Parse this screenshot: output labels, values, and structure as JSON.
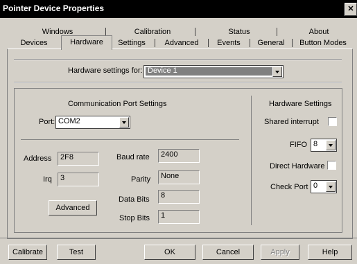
{
  "window": {
    "title": "Pointer Device Properties",
    "close_glyph": "✕"
  },
  "tabs_row1": [
    "Windows",
    "Calibration",
    "Status",
    "About"
  ],
  "tabs_row2": [
    "Devices",
    "Hardware",
    "Settings",
    "Advanced",
    "Events",
    "General",
    "Button Modes"
  ],
  "active_tab": "Hardware",
  "hardware_settings_for": {
    "label": "Hardware settings for:",
    "value": "Device 1"
  },
  "comm_port": {
    "heading": "Communication Port Settings",
    "port_label": "Port:",
    "port_value": "COM2",
    "address_label": "Address",
    "address_value": "2F8",
    "irq_label": "Irq",
    "irq_value": "3",
    "advanced_label": "Advanced",
    "baud_label": "Baud rate",
    "baud_value": "2400",
    "parity_label": "Parity",
    "parity_value": "None",
    "databits_label": "Data Bits",
    "databits_value": "8",
    "stopbits_label": "Stop Bits",
    "stopbits_value": "1"
  },
  "hardware_settings": {
    "heading": "Hardware Settings",
    "shared_interrupt_label": "Shared interrupt",
    "fifo_label": "FIFO",
    "fifo_value": "8",
    "direct_hardware_label": "Direct Hardware",
    "check_port_label": "Check Port",
    "check_port_value": "0"
  },
  "buttons": {
    "calibrate": "Calibrate",
    "test": "Test",
    "ok": "OK",
    "cancel": "Cancel",
    "apply": "Apply",
    "help": "Help"
  }
}
